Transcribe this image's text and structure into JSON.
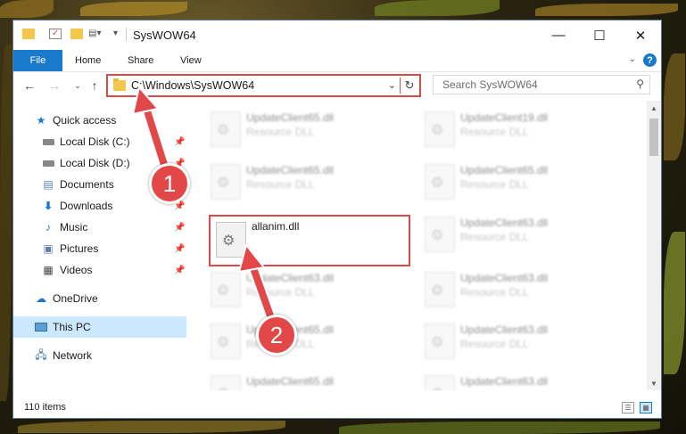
{
  "window": {
    "title": "SysWOW64",
    "controls": {
      "minimize": "—",
      "maximize": "☐",
      "close": "✕"
    }
  },
  "ribbon": {
    "file": "File",
    "tabs": [
      "Home",
      "Share",
      "View"
    ],
    "help": "?"
  },
  "navigation": {
    "address": "C:\\Windows\\SysWOW64",
    "search_placeholder": "Search SysWOW64"
  },
  "sidebar": {
    "items": [
      {
        "label": "Quick access",
        "icon": "star-icon",
        "pinned": false
      },
      {
        "label": "Local Disk (C:)",
        "icon": "drive-icon",
        "pinned": true
      },
      {
        "label": "Local Disk (D:)",
        "icon": "drive-icon",
        "pinned": true
      },
      {
        "label": "Documents",
        "icon": "documents-icon",
        "pinned": true
      },
      {
        "label": "Downloads",
        "icon": "downloads-icon",
        "pinned": true
      },
      {
        "label": "Music",
        "icon": "music-icon",
        "pinned": true
      },
      {
        "label": "Pictures",
        "icon": "pictures-icon",
        "pinned": true
      },
      {
        "label": "Videos",
        "icon": "videos-icon",
        "pinned": true
      },
      {
        "label": "OneDrive",
        "icon": "cloud-icon",
        "pinned": false
      },
      {
        "label": "This PC",
        "icon": "computer-icon",
        "pinned": false,
        "selected": true
      },
      {
        "label": "Network",
        "icon": "network-icon",
        "pinned": false
      }
    ]
  },
  "files": [
    {
      "name": "UpdateClient65.dll",
      "type": "Resource DLL"
    },
    {
      "name": "UpdateClient19.dll",
      "type": "Resource DLL"
    },
    {
      "name": "UpdateClient65.dll",
      "type": "Resource DLL"
    },
    {
      "name": "UpdateClient65.dll",
      "type": "Resource DLL"
    },
    {
      "name": "allanim.dll",
      "type": "",
      "highlighted": true
    },
    {
      "name": "UpdateClient63.dll",
      "type": "Resource DLL"
    },
    {
      "name": "UpdateClient63.dll",
      "type": "Resource DLL"
    },
    {
      "name": "UpdateClient63.dll",
      "type": "Resource DLL"
    },
    {
      "name": "UpdateClient65.dll",
      "type": "Resource DLL"
    },
    {
      "name": "UpdateClient63.dll",
      "type": "Resource DLL"
    },
    {
      "name": "UpdateClient65.dll",
      "type": "Resource DLL"
    },
    {
      "name": "UpdateClient63.dll",
      "type": "Resource DLL"
    }
  ],
  "status": {
    "item_count": "110 items"
  },
  "annotations": {
    "step1": "1",
    "step2": "2"
  },
  "colors": {
    "accent": "#1979ca",
    "highlight": "#d94b4b",
    "selected": "#cce8ff",
    "marker": "#e24848"
  }
}
